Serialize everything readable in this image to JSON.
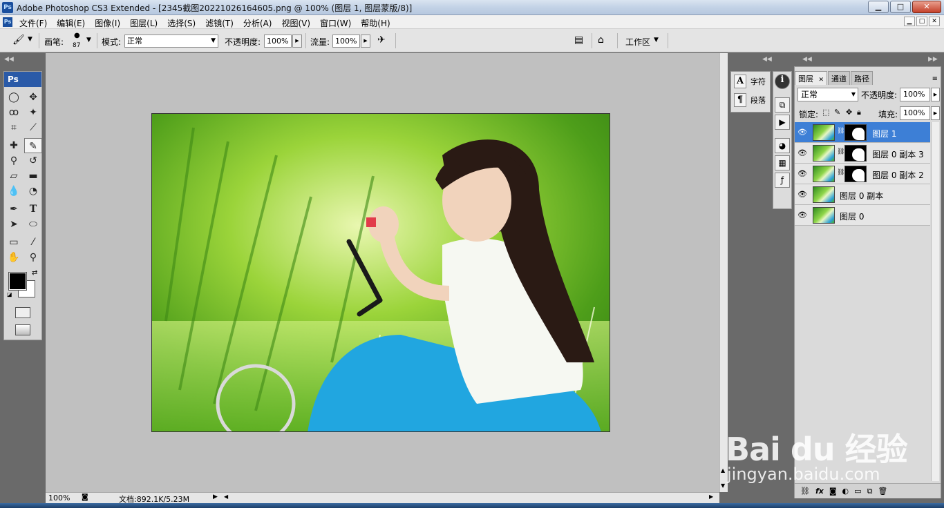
{
  "window": {
    "title": "Adobe Photoshop CS3 Extended - [2345截图20221026164605.png @ 100% (图层 1, 图层蒙版/8)]",
    "app_icon": "Ps",
    "buttons": {
      "minimize": "▁",
      "maximize": "□",
      "close": "✕"
    }
  },
  "menu": {
    "items": [
      "文件(F)",
      "编辑(E)",
      "图像(I)",
      "图层(L)",
      "选择(S)",
      "滤镜(T)",
      "分析(A)",
      "视图(V)",
      "窗口(W)",
      "帮助(H)"
    ],
    "doc_buttons": [
      "▁",
      "□",
      "✕"
    ]
  },
  "options_bar": {
    "brush_label": "画笔:",
    "brush_size": "87",
    "mode_label": "模式:",
    "mode_value": "正常",
    "opacity_label": "不透明度:",
    "opacity_value": "100%",
    "flow_label": "流量:",
    "flow_value": "100%",
    "workspace_label": "工作区"
  },
  "toolbox": {
    "header": "Ps",
    "icons": [
      "marquee-icon",
      "move-icon",
      "lasso-icon",
      "magic-wand-icon",
      "crop-icon",
      "slice-icon",
      "healing-brush-icon",
      "brush-icon",
      "clone-stamp-icon",
      "history-brush-icon",
      "eraser-icon",
      "gradient-icon",
      "blur-icon",
      "dodge-icon",
      "pen-icon",
      "type-icon",
      "path-selection-icon",
      "shape-icon",
      "notes-icon",
      "eyedropper-icon",
      "hand-icon",
      "zoom-icon"
    ],
    "foreground_color": "#000000",
    "background_color": "#ffffff"
  },
  "status": {
    "zoom": "100%",
    "doc_info": "文档:892.1K/5.23M"
  },
  "char_panel": {
    "items": [
      "字符",
      "段落"
    ]
  },
  "layers_panel": {
    "tabs": [
      "图层",
      "通道",
      "路径"
    ],
    "blend_mode": "正常",
    "opacity_label": "不透明度:",
    "opacity_value": "100%",
    "lock_label": "锁定:",
    "fill_label": "填充:",
    "fill_value": "100%",
    "layers": [
      {
        "name": "图层 1",
        "has_mask": true,
        "selected": true
      },
      {
        "name": "图层 0 副本 3",
        "has_mask": true,
        "selected": false
      },
      {
        "name": "图层 0 副本 2",
        "has_mask": true,
        "selected": false
      },
      {
        "name": "图层 0 副本",
        "has_mask": false,
        "selected": false
      },
      {
        "name": "图层 0",
        "has_mask": false,
        "selected": false
      }
    ]
  },
  "watermark": {
    "brand": "Bai du 经验",
    "url": "jingyan.baidu.com"
  },
  "colors": {
    "selection": "#3d7fd6",
    "canvas_bg": "#c0c0c0",
    "panel_bg": "#dadada"
  }
}
